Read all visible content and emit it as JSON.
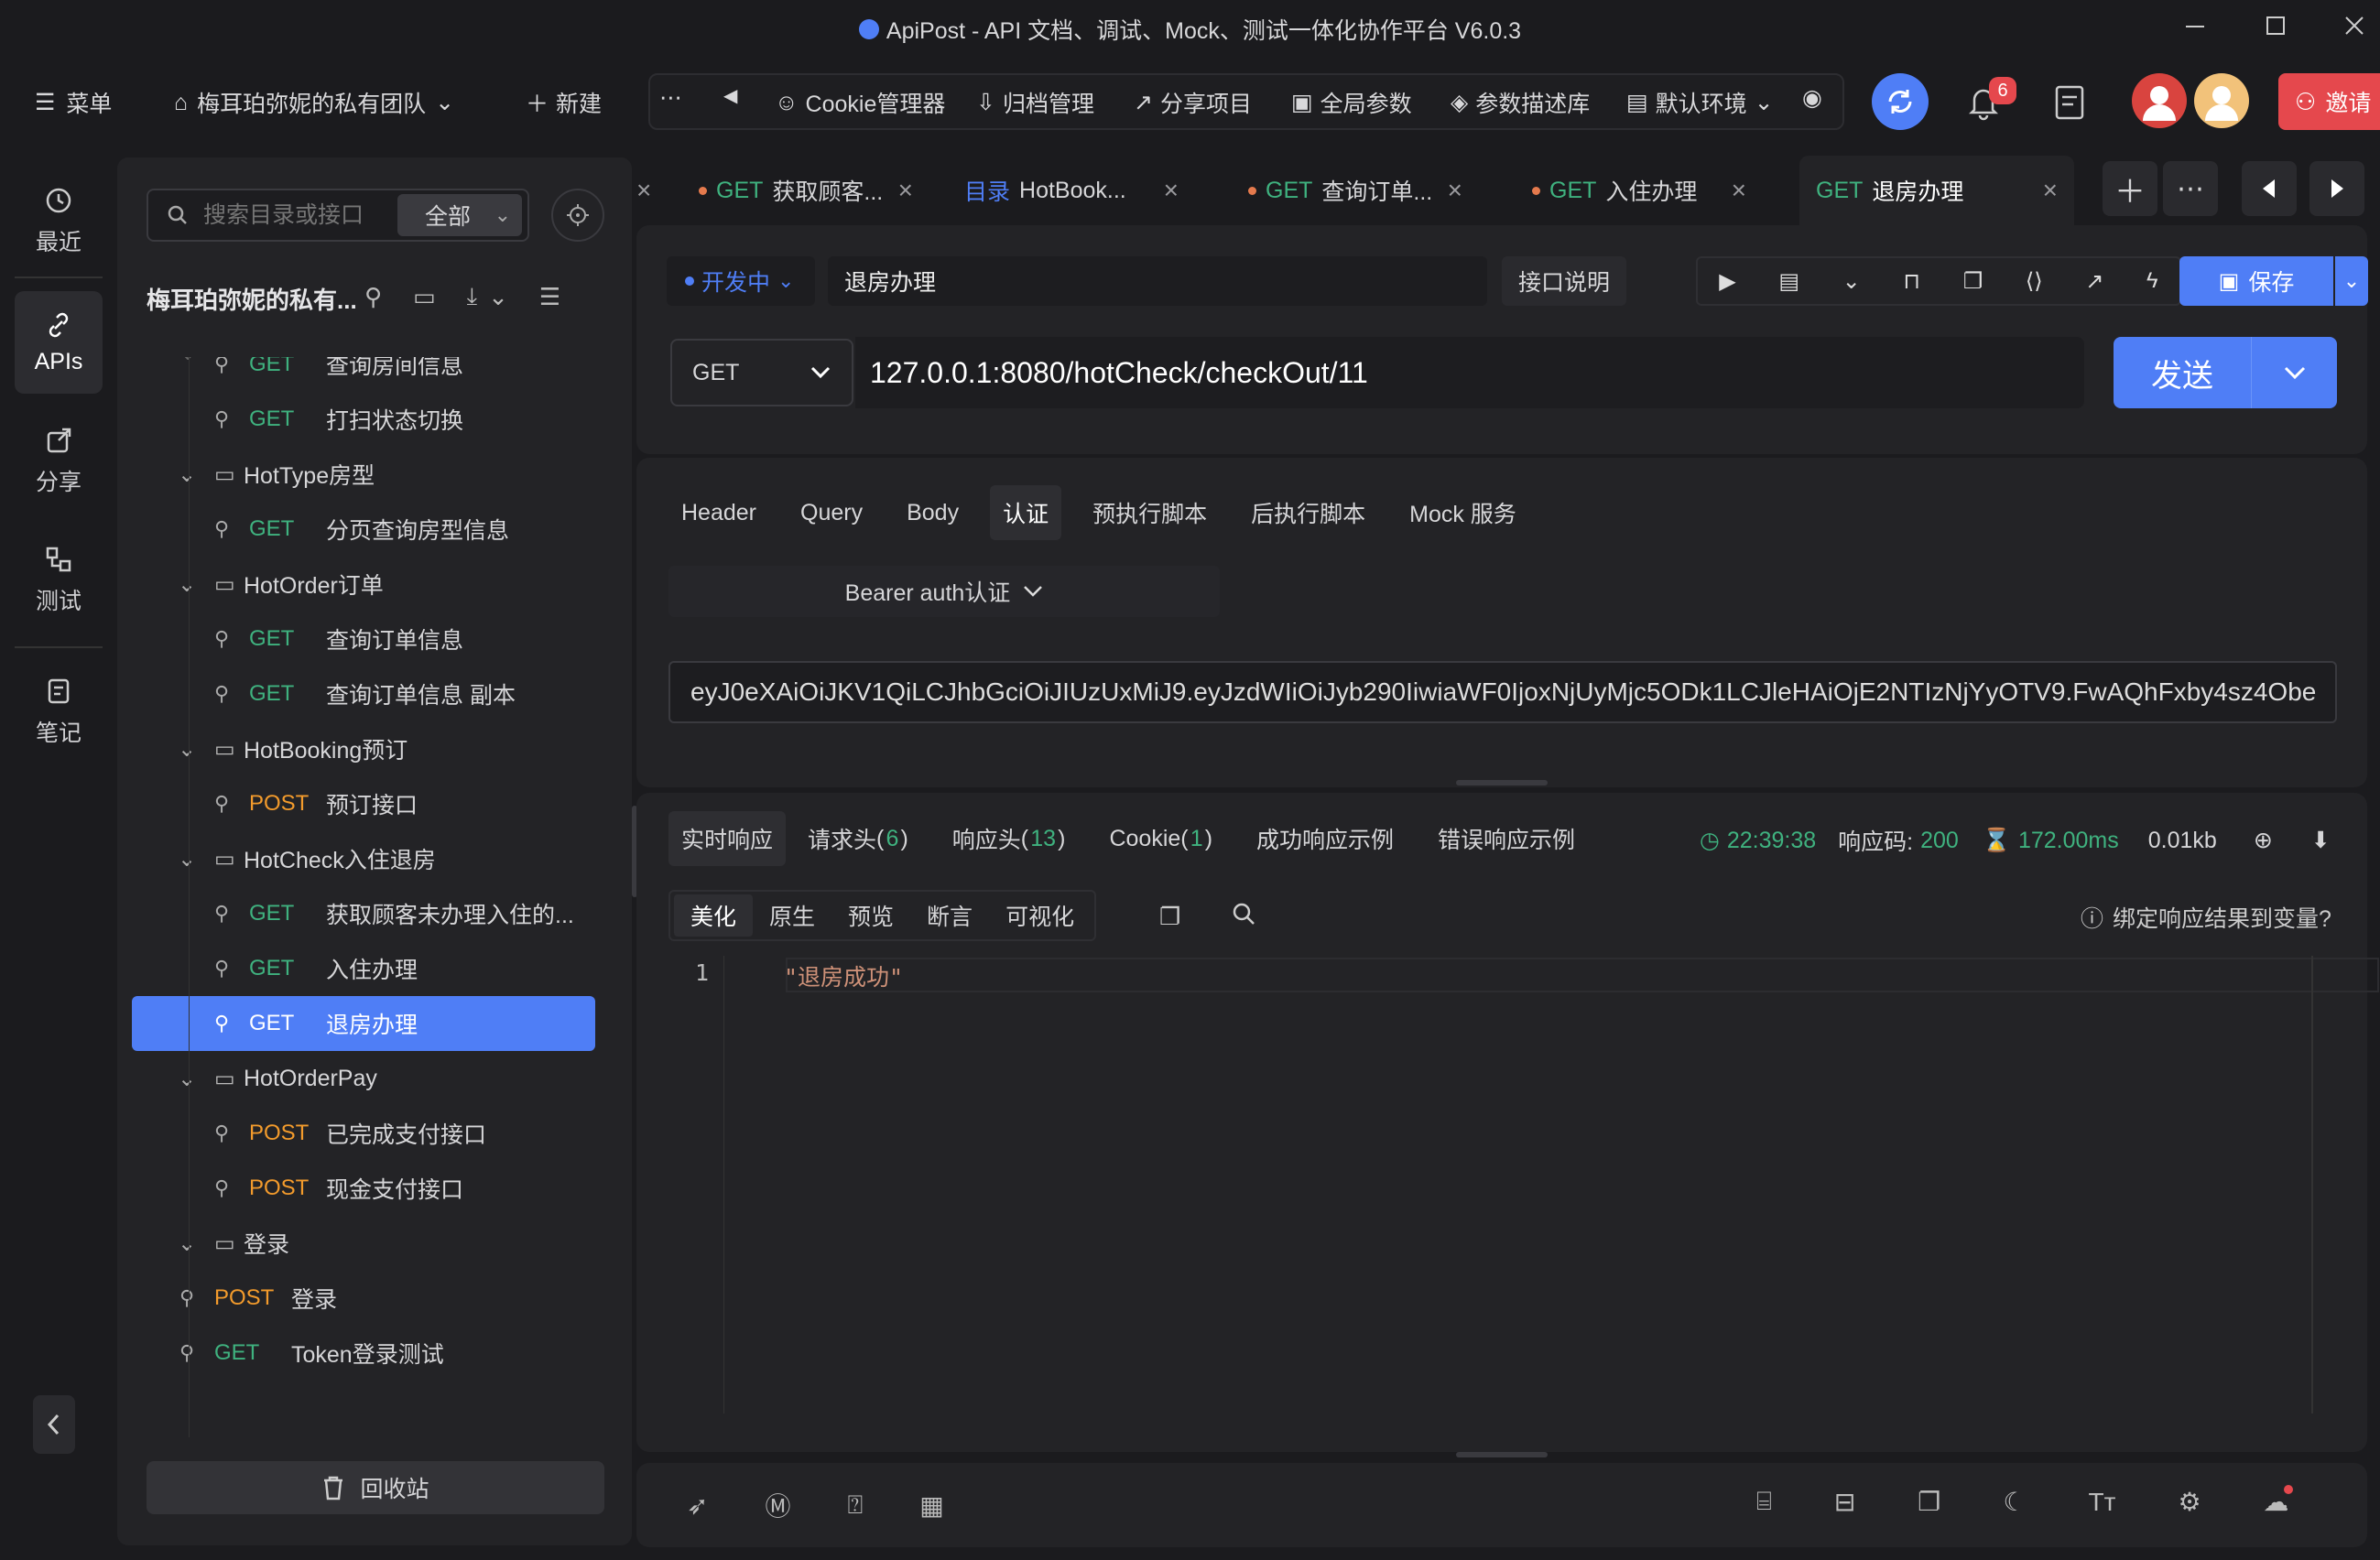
{
  "window": {
    "title": "ApiPost - API 文档、调试、Mock、测试一体化协作平台 V6.0.3"
  },
  "toolbar": {
    "menu_label": "菜单",
    "team_label": "梅耳珀弥妮的私有团队",
    "new_label": "新建",
    "items": [
      "Cookie管理器",
      "归档管理",
      "分享项目",
      "全局参数",
      "参数描述库",
      "默认环境"
    ],
    "notification_count": "6",
    "invite_label": "邀请"
  },
  "leftnav": {
    "items": [
      "最近",
      "APIs",
      "分享",
      "测试",
      "笔记"
    ]
  },
  "sidebar": {
    "search_placeholder": "搜索目录或接口",
    "filter_value": "全部",
    "project_name": "梅耳珀弥妮的私有...",
    "recycle_label": "回收站",
    "tree": [
      {
        "type": "api",
        "method": "GET",
        "name": "查询房间信息"
      },
      {
        "type": "api",
        "method": "GET",
        "name": "打扫状态切换"
      },
      {
        "type": "folder",
        "name": "HotType房型"
      },
      {
        "type": "api",
        "method": "GET",
        "name": "分页查询房型信息"
      },
      {
        "type": "folder",
        "name": "HotOrder订单"
      },
      {
        "type": "api",
        "method": "GET",
        "name": "查询订单信息"
      },
      {
        "type": "api",
        "method": "GET",
        "name": "查询订单信息 副本"
      },
      {
        "type": "folder",
        "name": "HotBooking预订"
      },
      {
        "type": "api",
        "method": "POST",
        "name": "预订接口"
      },
      {
        "type": "folder",
        "name": "HotCheck入住退房"
      },
      {
        "type": "api",
        "method": "GET",
        "name": "获取顾客未办理入住的..."
      },
      {
        "type": "api",
        "method": "GET",
        "name": "入住办理"
      },
      {
        "type": "api",
        "method": "GET",
        "name": "退房办理",
        "selected": true
      },
      {
        "type": "folder",
        "name": "HotOrderPay"
      },
      {
        "type": "api",
        "method": "POST",
        "name": "已完成支付接口"
      },
      {
        "type": "api",
        "method": "POST",
        "name": "现金支付接口"
      },
      {
        "type": "folder",
        "name": "登录"
      },
      {
        "type": "api",
        "method": "POST",
        "name": "登录"
      },
      {
        "type": "api",
        "method": "GET",
        "name": "Token登录测试"
      }
    ]
  },
  "tabs": [
    {
      "method": "GET",
      "label": "获取顾客..."
    },
    {
      "method": "目录",
      "label": "HotBook..."
    },
    {
      "method": "GET",
      "label": "查询订单..."
    },
    {
      "method": "GET",
      "label": "入住办理"
    },
    {
      "method": "GET",
      "label": "退房办理",
      "active": true
    }
  ],
  "request": {
    "status": "开发中",
    "name": "退房办理",
    "doc_label": "接口说明",
    "save_label": "保存",
    "method": "GET",
    "url": "127.0.0.1:8080/hotCheck/checkOut/11",
    "send_label": "发送"
  },
  "req_tabs": [
    "Header",
    "Query",
    "Body",
    "认证",
    "预执行脚本",
    "后执行脚本",
    "Mock 服务"
  ],
  "auth": {
    "type": "Bearer auth认证",
    "token": "eyJ0eXAiOiJKV1QiLCJhbGciOiJIUzUxMiJ9.eyJzdWIiOiJyb290IiwiaWF0IjoxNjUyMjc5ODk1LCJleHAiOjE2NTIzNjYyOTV9.FwAQhFxby4sz4Obe"
  },
  "response": {
    "tabs": [
      "实时响应",
      "请求头",
      "响应头",
      "Cookie",
      "成功响应示例",
      "错误响应示例"
    ],
    "req_header_count": "6",
    "resp_header_count": "13",
    "cookie_count": "1",
    "time": "22:39:38",
    "code_label": "响应码:",
    "code": "200",
    "duration": "172.00ms",
    "size": "0.01kb",
    "views": [
      "美化",
      "原生",
      "预览",
      "断言",
      "可视化"
    ],
    "bind_label": "绑定响应结果到变量?",
    "line_no": "1",
    "body": "\"退房成功\""
  },
  "colors": {
    "accent": "#4f7ef6",
    "get": "#3fb27f",
    "post": "#f39b2c",
    "danger": "#e5484d",
    "status": "#4f7ef6"
  }
}
